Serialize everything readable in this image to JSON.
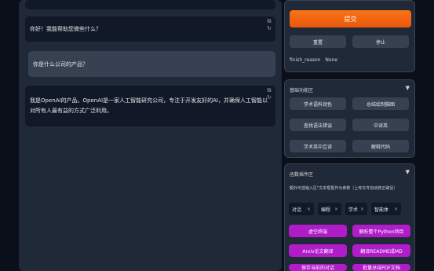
{
  "chat": {
    "messages": [
      {
        "role": "bot",
        "text": "你好！我能帮助您做些什么？"
      },
      {
        "role": "user",
        "text": "你是什么公司的产品？"
      },
      {
        "role": "bot",
        "text_line1": "我是OpenAI的产品。OpenAI是一家人工智能研究公司，专注于开发友好的AI，并确保人工智能以",
        "text_line2": "对所有人最有益的方式广泛利用。"
      }
    ],
    "copy_icon": "⧉",
    "regen_icon": "↻"
  },
  "controls": {
    "submit_label": "提交",
    "reset_label": "重置",
    "stop_label": "停止",
    "finish_reason_label": "finish_reason",
    "finish_reason_value": "None"
  },
  "basic_panel": {
    "title": "基础功能区",
    "toggle": "▼",
    "buttons": [
      "学术语料润色",
      "总结绘制脑图",
      "查找语法错误",
      "中译英",
      "学术英中互译",
      "解释代码"
    ]
  },
  "plugin_panel": {
    "title": "函数插件区",
    "toggle": "▼",
    "hint": "额外可选输入区\"文本框框作为参数（上传文件自动修正路径）",
    "tags": [
      "对话",
      "编程",
      "学术",
      "智能体"
    ],
    "tag_close": "×",
    "buttons": [
      "虚空终端",
      "解析整个Python项目",
      "Arxiv论文翻译",
      "翻译README成MD",
      "保存当前的对话",
      "批量总结PDF文档"
    ]
  }
}
